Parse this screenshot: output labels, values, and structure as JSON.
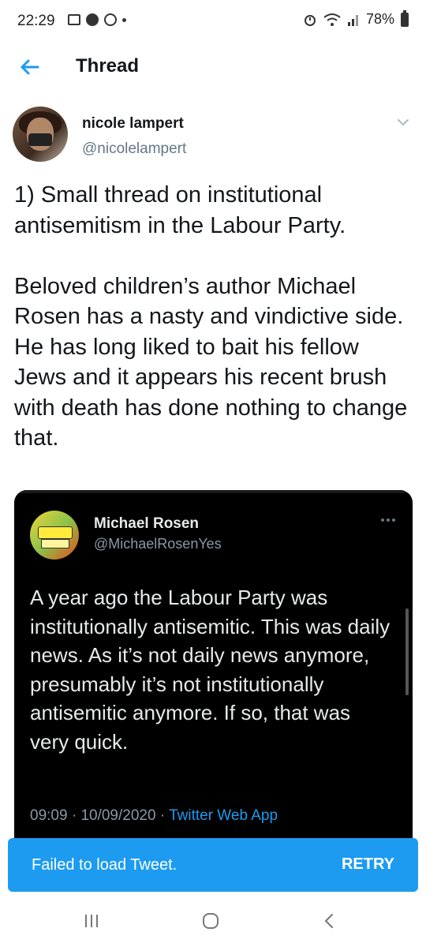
{
  "status_bar": {
    "time": "22:29",
    "battery": "78%"
  },
  "header": {
    "title": "Thread",
    "back_icon": "arrow-left-icon"
  },
  "tweet": {
    "author_name": "nicole lampert",
    "author_handle": "@nicolelampert",
    "text": "1) Small thread on institutional antisemitism in the Labour Party.\n\nBeloved children’s author Michael Rosen has a nasty and vindictive side. He has long liked to bait his fellow Jews and it appears his recent brush with death has done nothing to change that."
  },
  "quoted_tweet": {
    "author_name": "Michael Rosen",
    "author_handle": "@MichaelRosenYes",
    "text": "A year ago the Labour Party was institutionally antisemitic. This was daily news. As it’s not daily news anymore, presumably it’s not institutionally antisemitic anymore. If so, that was very quick.",
    "time": "09:09",
    "date": "10/09/2020",
    "separator": "·",
    "app": "Twitter Web App"
  },
  "toast": {
    "message": "Failed to load Tweet.",
    "action": "RETRY"
  },
  "colors": {
    "accent": "#1d9bf0",
    "text": "#14171a",
    "secondary": "#657786"
  }
}
